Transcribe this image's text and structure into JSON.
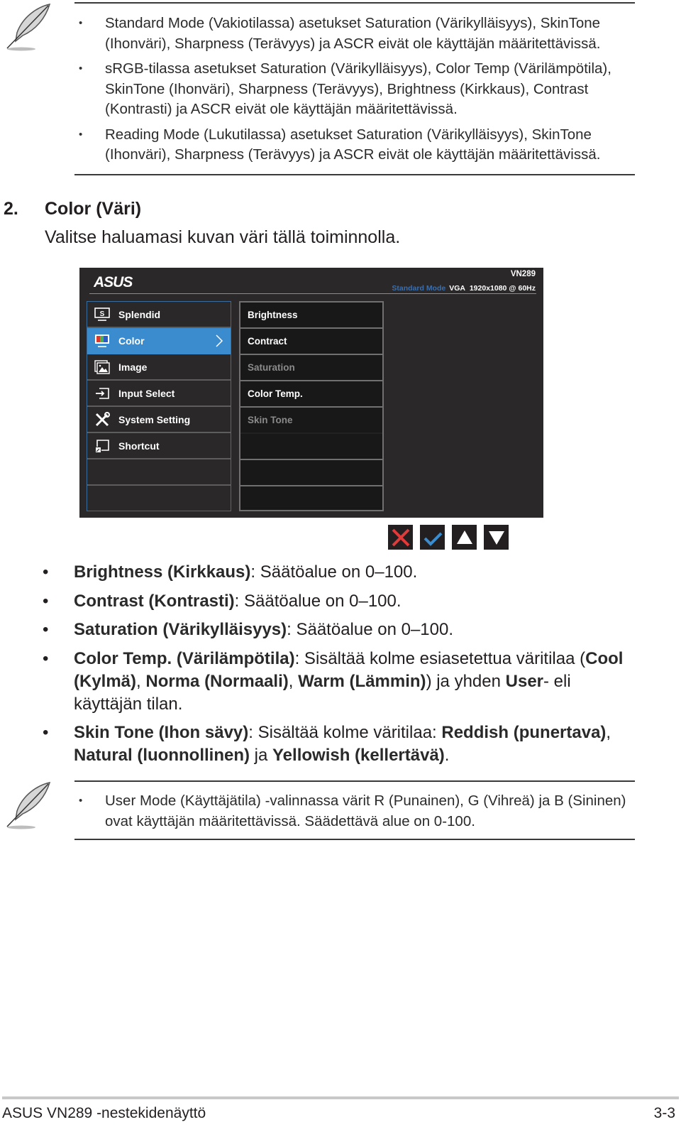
{
  "notes_top": [
    "Standard Mode (Vakiotilassa) asetukset Saturation (Värikylläisyys), SkinTone (Ihonväri), Sharpness (Terävyys) ja ASCR eivät ole käyttäjän määritettävissä.",
    "sRGB-tilassa asetukset Saturation (Värikylläisyys), Color Temp (Värilämpötila), SkinTone (Ihonväri), Sharpness (Terävyys), Brightness (Kirkkaus), Contrast (Kontrasti) ja ASCR eivät ole käyttäjän määritettävissä.",
    "Reading Mode (Lukutilassa) asetukset Saturation (Värikylläisyys), SkinTone (Ihonväri), Sharpness (Terävyys) ja ASCR eivät ole käyttäjän määritettävissä."
  ],
  "section": {
    "number": "2.",
    "title": "Color (Väri)",
    "description": "Valitse haluamasi kuvan väri tällä toiminnolla."
  },
  "osd": {
    "brand": "ASUS",
    "model": "VN289",
    "mode": "Standard Mode",
    "input": "VGA",
    "resolution": "1920x1080 @ 60Hz",
    "accent_color": "#3a8ccf",
    "main_menu": [
      {
        "label": "Splendid",
        "icon": "splendid-icon",
        "selected": false
      },
      {
        "label": "Color",
        "icon": "color-icon",
        "selected": true
      },
      {
        "label": "Image",
        "icon": "image-icon",
        "selected": false
      },
      {
        "label": "Input Select",
        "icon": "input-select-icon",
        "selected": false
      },
      {
        "label": "System Setting",
        "icon": "system-setting-icon",
        "selected": false
      },
      {
        "label": "Shortcut",
        "icon": "shortcut-icon",
        "selected": false
      },
      {
        "label": "",
        "icon": "",
        "selected": false
      },
      {
        "label": "",
        "icon": "",
        "selected": false
      }
    ],
    "sub_menu": [
      {
        "label": "Brightness",
        "enabled": true
      },
      {
        "label": "Contract",
        "enabled": true
      },
      {
        "label": "Saturation",
        "enabled": false
      },
      {
        "label": "Color Temp.",
        "enabled": true
      },
      {
        "label": "Skin Tone",
        "enabled": false
      },
      {
        "label": "",
        "enabled": true
      },
      {
        "label": "",
        "enabled": true
      },
      {
        "label": "",
        "enabled": true
      }
    ],
    "keys": [
      {
        "name": "close-key",
        "icon": "close-icon",
        "color": "#e03a3a"
      },
      {
        "name": "confirm-key",
        "icon": "check-icon",
        "color": "#3a8ccf"
      },
      {
        "name": "up-key",
        "icon": "triangle-up-icon",
        "color": "#ffffff"
      },
      {
        "name": "down-key",
        "icon": "triangle-down-icon",
        "color": "#ffffff"
      }
    ]
  },
  "features": [
    {
      "bold": "Brightness (Kirkkaus)",
      "text": ": Säätöalue on 0–100."
    },
    {
      "bold": "Contrast (Kontrasti)",
      "text": ": Säätöalue on 0–100."
    },
    {
      "bold": "Saturation (Värikylläisyys)",
      "text": ": Säätöalue on 0–100."
    },
    {
      "bold": "Color Temp. (Värilämpötila)",
      "text": ": Sisältää kolme esiasetettua väritilaa (",
      "b2": "Cool (Kylmä)",
      "t2": ", ",
      "b3": "Norma (Normaali)",
      "t3": ", ",
      "b4": "Warm (Lämmin)",
      "t4": ") ja yhden ",
      "b5": "User",
      "t5": "- eli käyttäjän tilan."
    },
    {
      "bold": "Skin Tone (Ihon sävy)",
      "text": ": Sisältää kolme väritilaa: ",
      "b2": "Reddish (punertava)",
      "t2": ", ",
      "b3": "Natural (luonnollinen)",
      "t3": " ja ",
      "b4": "Yellowish (kellertävä)",
      "t4": "."
    }
  ],
  "note_bottom": "User Mode (Käyttäjätila) -valinnassa värit R (Punainen), G (Vihreä) ja B (Sininen) ovat käyttäjän määritettävissä. Säädettävä alue on 0-100.",
  "footer": {
    "title": "ASUS VN289 -nestekidenäyttö",
    "page": "3-3"
  }
}
